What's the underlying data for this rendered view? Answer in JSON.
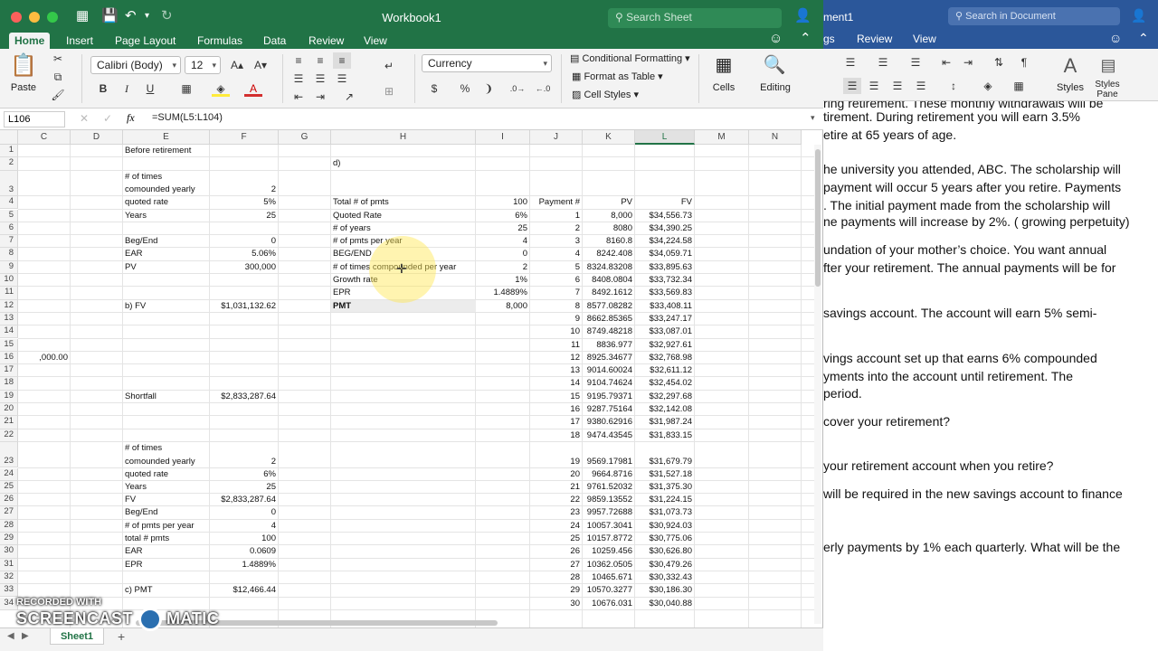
{
  "excel": {
    "window_title": "Workbook1",
    "search_placeholder": "Search Sheet",
    "tabs": [
      "Home",
      "Insert",
      "Page Layout",
      "Formulas",
      "Data",
      "Review",
      "View"
    ],
    "ribbon": {
      "paste": "Paste",
      "font_name": "Calibri (Body)",
      "font_size": "12",
      "number_format": "Currency",
      "conditional_formatting": "Conditional Formatting",
      "format_as_table": "Format as Table",
      "cell_styles": "Cell Styles",
      "cells": "Cells",
      "editing": "Editing",
      "bold": "B",
      "italic": "I",
      "underline": "U",
      "dollar": "$",
      "percent": "%",
      "comma": "❩"
    },
    "name_box": "L106",
    "fx": "fx",
    "formula": "=SUM(L5:L104)",
    "columns": [
      "C",
      "D",
      "E",
      "F",
      "G",
      "H",
      "I",
      "J",
      "K",
      "L",
      "M",
      "N"
    ],
    "rows": [
      {
        "n": "1",
        "E": "Before retirement"
      },
      {
        "n": "2",
        "H": "d)"
      },
      {
        "n": "3",
        "E": "# of times",
        "E2": "comounded yearly",
        "F": "2"
      },
      {
        "n": "4",
        "E": "quoted rate",
        "F": "5%",
        "H": "Total # of pmts",
        "I": "100",
        "J": "Payment #",
        "K": "PV",
        "L": "FV"
      },
      {
        "n": "5",
        "E": "Years",
        "F": "25",
        "H": "Quoted Rate",
        "I": "6%",
        "J": "1",
        "K": "8,000",
        "L": "$34,556.73"
      },
      {
        "n": "6",
        "H": "# of years",
        "I": "25",
        "J": "2",
        "K": "8080",
        "L": "$34,390.25"
      },
      {
        "n": "7",
        "E": "Beg/End",
        "F": "0",
        "H": "# of pmts per year",
        "I": "4",
        "J": "3",
        "K": "8160.8",
        "L": "$34,224.58"
      },
      {
        "n": "8",
        "E": "EAR",
        "F": "5.06%",
        "H": "BEG/END",
        "I": "0",
        "J": "4",
        "K": "8242.408",
        "L": "$34,059.71"
      },
      {
        "n": "9",
        "E": "PV",
        "F": "300,000",
        "H": "# of times compounded per year",
        "I": "2",
        "J": "5",
        "K": "8324.83208",
        "L": "$33,895.63"
      },
      {
        "n": "10",
        "H": "Growth rate",
        "I": "1%",
        "J": "6",
        "K": "8408.0804",
        "L": "$33,732.34"
      },
      {
        "n": "11",
        "H": "EPR",
        "I": "1.4889%",
        "J": "7",
        "K": "8492.1612",
        "L": "$33,569.83"
      },
      {
        "n": "12",
        "E": "b) FV",
        "F": "$1,031,132.62",
        "H": "PMT",
        "I": "8,000",
        "J": "8",
        "K": "8577.08282",
        "L": "$33,408.11"
      },
      {
        "n": "13",
        "J": "9",
        "K": "8662.85365",
        "L": "$33,247.17"
      },
      {
        "n": "14",
        "J": "10",
        "K": "8749.48218",
        "L": "$33,087.01"
      },
      {
        "n": "15",
        "J": "11",
        "K": "8836.977",
        "L": "$32,927.61"
      },
      {
        "n": "16",
        "C": ",000.00",
        "J": "12",
        "K": "8925.34677",
        "L": "$32,768.98"
      },
      {
        "n": "17",
        "J": "13",
        "K": "9014.60024",
        "L": "$32,611.12"
      },
      {
        "n": "18",
        "J": "14",
        "K": "9104.74624",
        "L": "$32,454.02"
      },
      {
        "n": "19",
        "E": "Shortfall",
        "F": "$2,833,287.64",
        "J": "15",
        "K": "9195.79371",
        "L": "$32,297.68"
      },
      {
        "n": "20",
        "J": "16",
        "K": "9287.75164",
        "L": "$32,142.08"
      },
      {
        "n": "21",
        "J": "17",
        "K": "9380.62916",
        "L": "$31,987.24"
      },
      {
        "n": "22",
        "J": "18",
        "K": "9474.43545",
        "L": "$31,833.15"
      },
      {
        "n": "23",
        "E": "# of times",
        "E2": "comounded yearly",
        "F": "2",
        "J": "19",
        "K": "9569.17981",
        "L": "$31,679.79"
      },
      {
        "n": "24",
        "E": "quoted rate",
        "F": "6%",
        "J": "20",
        "K": "9664.8716",
        "L": "$31,527.18"
      },
      {
        "n": "25",
        "E": "Years",
        "F": "25",
        "J": "21",
        "K": "9761.52032",
        "L": "$31,375.30"
      },
      {
        "n": "26",
        "E": "FV",
        "F": "$2,833,287.64",
        "J": "22",
        "K": "9859.13552",
        "L": "$31,224.15"
      },
      {
        "n": "27",
        "E": "Beg/End",
        "F": "0",
        "J": "23",
        "K": "9957.72688",
        "L": "$31,073.73"
      },
      {
        "n": "28",
        "E": "# of pmts per year",
        "F": "4",
        "J": "24",
        "K": "10057.3041",
        "L": "$30,924.03"
      },
      {
        "n": "29",
        "E": "total # pmts",
        "F": "100",
        "J": "25",
        "K": "10157.8772",
        "L": "$30,775.06"
      },
      {
        "n": "30",
        "E": "EAR",
        "F": "0.0609",
        "J": "26",
        "K": "10259.456",
        "L": "$30,626.80"
      },
      {
        "n": "31",
        "E": "EPR",
        "F": "1.4889%",
        "J": "27",
        "K": "10362.0505",
        "L": "$30,479.26"
      },
      {
        "n": "32",
        "J": "28",
        "K": "10465.671",
        "L": "$30,332.43"
      },
      {
        "n": "33",
        "E": "c) PMT",
        "F": "$12,466.44",
        "J": "29",
        "K": "10570.3277",
        "L": "$30,186.30"
      },
      {
        "n": "34",
        "J": "30",
        "K": "10676.031",
        "L": "$30,040.88"
      }
    ],
    "sheet_tab": "Sheet1",
    "watermark_top": "RECORDED WITH",
    "watermark_bottom": "SCREENCAST",
    "watermark_bottom2": "MATIC"
  },
  "word": {
    "window_title": "ment1",
    "search_placeholder": "Search in Document",
    "tabs": [
      "gs",
      "Review",
      "View"
    ],
    "styles": "Styles",
    "styles_pane": "Styles Pane",
    "lines": [
      "ring retirement. These monthly withdrawals will be",
      "tirement. During retirement you will earn 3.5%",
      "etire at 65 years of age.",
      "he university you attended, ABC. The scholarship will",
      "payment will occur 5 years after you retire. Payments",
      ". The initial payment made from the scholarship will",
      "ne payments will increase by 2%. ( growing perpetuity)",
      "undation of your mother’s choice. You want annual",
      "fter your retirement. The annual payments will be for",
      "savings account. The account will earn 5% semi-",
      "vings account set up that earns 6% compounded",
      "yments into the account until retirement. The",
      " period.",
      "cover your retirement?",
      " your retirement account when you retire?",
      "will be required in the new savings account to finance",
      "erly payments by 1% each quarterly. What will be the"
    ]
  }
}
